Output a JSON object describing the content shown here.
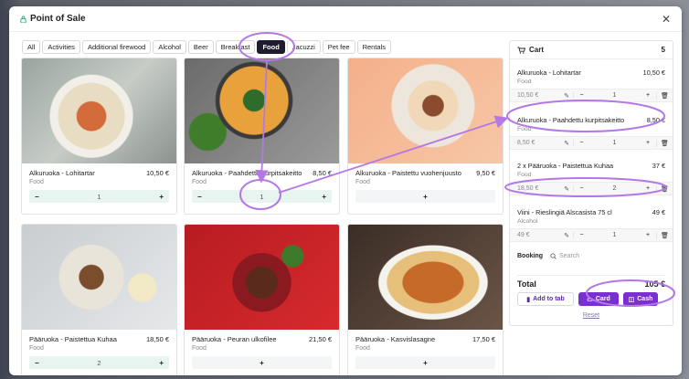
{
  "modal": {
    "title": "Point of Sale"
  },
  "tabs": [
    "All",
    "Activities",
    "Additional firewood",
    "Alcohol",
    "Beer",
    "Breakfast",
    "Food",
    "Jacuzzi",
    "Pet fee",
    "Rentals"
  ],
  "active_tab": "Food",
  "products": [
    {
      "name": "Alkuruoka - Lohitartar",
      "price": "10,50 €",
      "category": "Food",
      "qty": "1",
      "controls": "filled",
      "icon": "salmon-tartare-image"
    },
    {
      "name": "Alkuruoka - Paahdettu kurpitsakeitto",
      "price": "8,50 €",
      "category": "Food",
      "qty": "1",
      "controls": "filled",
      "icon": "pumpkin-soup-image"
    },
    {
      "name": "Alkuruoka - Paistettu vuohenjuusto",
      "price": "9,50 €",
      "category": "Food",
      "qty": "",
      "controls": "empty",
      "icon": "goat-cheese-image"
    },
    {
      "name": "Pääruoka - Paistettua Kuhaa",
      "price": "18,50 €",
      "category": "Food",
      "qty": "2",
      "controls": "filled",
      "icon": "pike-perch-image"
    },
    {
      "name": "Pääruoka - Peuran ulkofilee",
      "price": "21,50 €",
      "category": "Food",
      "qty": "",
      "controls": "empty",
      "icon": "deer-fillet-image"
    },
    {
      "name": "Pääruoka - Kasvislasagne",
      "price": "17,50 €",
      "category": "Food",
      "qty": "",
      "controls": "empty",
      "icon": "lasagne-image"
    }
  ],
  "cart": {
    "title": "Cart",
    "count": "5",
    "items": [
      {
        "name": "Alkuruoka - Lohitartar",
        "line_total": "10,50 €",
        "category": "Food",
        "unit_price": "10,50 €",
        "qty": "1"
      },
      {
        "name": "Alkuruoka - Paahdettu kurpitsakeitto",
        "line_total": "8,50 €",
        "category": "Food",
        "unit_price": "8,50 €",
        "qty": "1"
      },
      {
        "name": "2 x Pääruoka - Paistettua Kuhaa",
        "line_total": "37 €",
        "category": "Food",
        "unit_price": "18,50 €",
        "qty": "2"
      },
      {
        "name": "Viini - Rieslingiä Alscasista 75 cl",
        "line_total": "49 €",
        "category": "Alcohol",
        "unit_price": "49 €",
        "qty": "1"
      }
    ],
    "booking_label": "Booking",
    "search_placeholder": "Search",
    "total_label": "Total",
    "total_value": "105 €",
    "add_to_tab": "Add to tab",
    "card": "Card",
    "cash": "Cash",
    "reset": "Reset"
  },
  "colors": {
    "accent": "#7b2fd0",
    "annotation": "#b478e6",
    "qty_bg": "#e7f4ef"
  }
}
